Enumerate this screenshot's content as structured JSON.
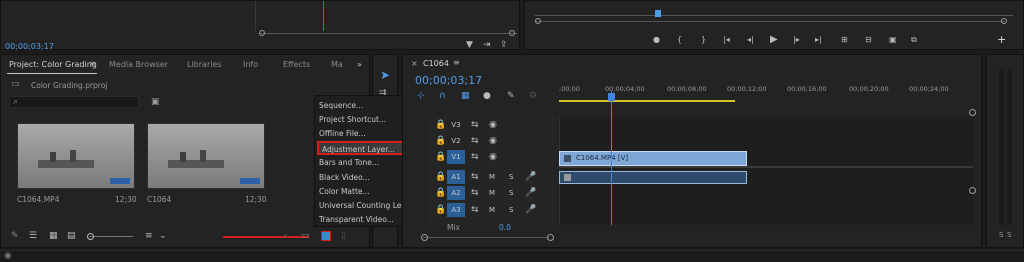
{
  "source_monitor": {
    "timecode": "00;00;03;17"
  },
  "program_monitor": {
    "transport_icons": [
      "marker-icon",
      "mark-in-icon",
      "mark-out-icon",
      "go-to-in-icon",
      "step-back-icon",
      "play-icon",
      "step-forward-icon",
      "go-to-out-icon",
      "lift-icon",
      "extract-icon",
      "camera-icon",
      "compare-icon"
    ],
    "add_button": "+"
  },
  "project_panel": {
    "tabs": [
      "Project: Color Grading",
      "Media Browser",
      "Libraries",
      "Info",
      "Effects",
      "Ma"
    ],
    "overflow": "»",
    "file_name": "Color Grading.prproj",
    "items": [
      {
        "name": "C1064.MP4",
        "duration": "12;30"
      },
      {
        "name": "C1064",
        "duration": "12;30"
      }
    ]
  },
  "new_item_menu": {
    "items": [
      "Sequence...",
      "Project Shortcut...",
      "Offline File...",
      "Adjustment Layer...",
      "Bars and Tone...",
      "Black Video...",
      "Color Matte...",
      "Universal Counting Leader...",
      "Transparent Video..."
    ],
    "highlighted_index": 3
  },
  "timeline": {
    "sequence_name": "C1064",
    "timecode": "00;00;03;17",
    "ruler": [
      ";00;00",
      "00;00;04;00",
      "00;00;08;00",
      "00;00;12;00",
      "00;00;16;00",
      "00;00;20;00",
      "00;00;24;00"
    ],
    "video_tracks": [
      "V3",
      "V2",
      "V1"
    ],
    "audio_tracks": [
      "A1",
      "A2",
      "A3"
    ],
    "audio_toggles": [
      "M",
      "S"
    ],
    "mix_label": "Mix",
    "mix_value": "0.0",
    "clip_label": "C1064.MP4 [V]",
    "playhead_fraction": 0.25
  },
  "meter": {
    "labels": [
      "S",
      "S"
    ]
  },
  "colors": {
    "accent": "#4e9ce8",
    "highlight_border": "#d11f1f",
    "clip": "#7ea7d6"
  }
}
